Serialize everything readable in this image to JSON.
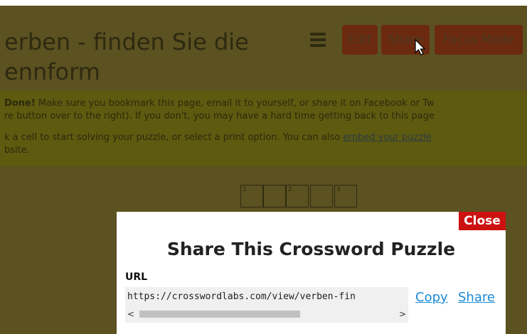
{
  "page": {
    "title_line1": "erben - finden Sie die",
    "title_line2": "ennform",
    "toolbar": {
      "edit": "Edit",
      "share": "Share",
      "focus": "Focus Mode"
    },
    "notice": {
      "bold": "Done!",
      "line1": " Make sure you bookmark this page, email it to yourself, or share it on Facebook or Tw",
      "line2": "re button over to the right). If you don't, you may have a hard time getting back to this page",
      "line3": "k a cell to start solving your puzzle, or select a print option. You can also ",
      "line3_link": "embed your puzzle",
      "line4": "bsite."
    },
    "grid_numbers": [
      "1",
      "2",
      "3"
    ]
  },
  "modal": {
    "close": "Close",
    "title": "Share This Crossword Puzzle",
    "url_label": "URL",
    "url_value": "https://crosswordlabs.com/view/verben-fin",
    "copy": "Copy",
    "share": "Share",
    "arrow_left": "<",
    "arrow_right": ">"
  },
  "colors": {
    "overlay": "#5b5120",
    "close_bg": "#cc1111",
    "link": "#1a8ad4"
  }
}
